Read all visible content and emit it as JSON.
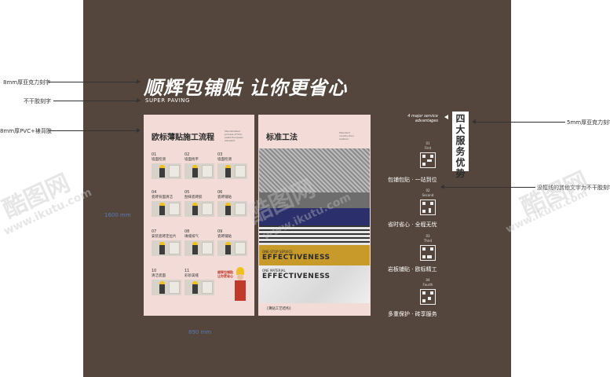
{
  "annotations": {
    "left_1": "8mm厚亚克力刻字",
    "left_2": "不干胶刻字",
    "left_3": "8mm厚PVC+裱背胶",
    "right_1": "5mm厚亚克力刻字",
    "right_2": "没框线的其他文字为不干胶刻字"
  },
  "dimensions": {
    "height": "1600 mm",
    "width": "890 mm"
  },
  "heading": {
    "title": "顺辉包铺贴 让你更省心",
    "subtitle": "SUPER PAVING"
  },
  "left_panel": {
    "title": "欧标薄贴施工流程",
    "mini_text": "Standardized process of thin-paste European standard",
    "steps": [
      {
        "num": "01",
        "label": "墙面检测"
      },
      {
        "num": "02",
        "label": "墙面找平"
      },
      {
        "num": "03",
        "label": "墙面检测"
      },
      {
        "num": "04",
        "label": "瓷砖背面清洁"
      },
      {
        "num": "05",
        "label": "刮抹瓷砖胶"
      },
      {
        "num": "06",
        "label": "瓷砖铺贴"
      },
      {
        "num": "07",
        "label": "安装瓷砖定位片"
      },
      {
        "num": "08",
        "label": "填缝排气"
      },
      {
        "num": "09",
        "label": "瓷砖铺贴"
      },
      {
        "num": "10",
        "label": "清洁瓷面"
      },
      {
        "num": "11",
        "label": "彩砂美缝"
      },
      {
        "num": "",
        "label": "顺辉包铺贴 让你更省心"
      }
    ]
  },
  "right_panel": {
    "title": "标准工法",
    "mini_text": "Standard construction method",
    "band_1_small": "ONE-STOP SERVICE",
    "band_1_big": "EFFECTIVENESS",
    "band_2_small": "ONE MATERIAL",
    "band_2_big": "EFFECTIVENESS",
    "footer": "[薄贴工艺结构]"
  },
  "services": {
    "vertical_title": "四大服务优势",
    "en_tag": "4 major service advantages",
    "items": [
      {
        "num": "01",
        "ord": "First",
        "label": "包铺包贴 · 一站到位"
      },
      {
        "num": "02",
        "ord": "Second",
        "label": "省时省心 · 全程无忧"
      },
      {
        "num": "03",
        "ord": "Third",
        "label": "岩板铺贴 · 欧标精工"
      },
      {
        "num": "04",
        "ord": "Fourth",
        "label": "多重保护 · 砖享服务"
      }
    ]
  },
  "watermark": {
    "brand": "酷图网",
    "url": "www.ikutu.com"
  }
}
